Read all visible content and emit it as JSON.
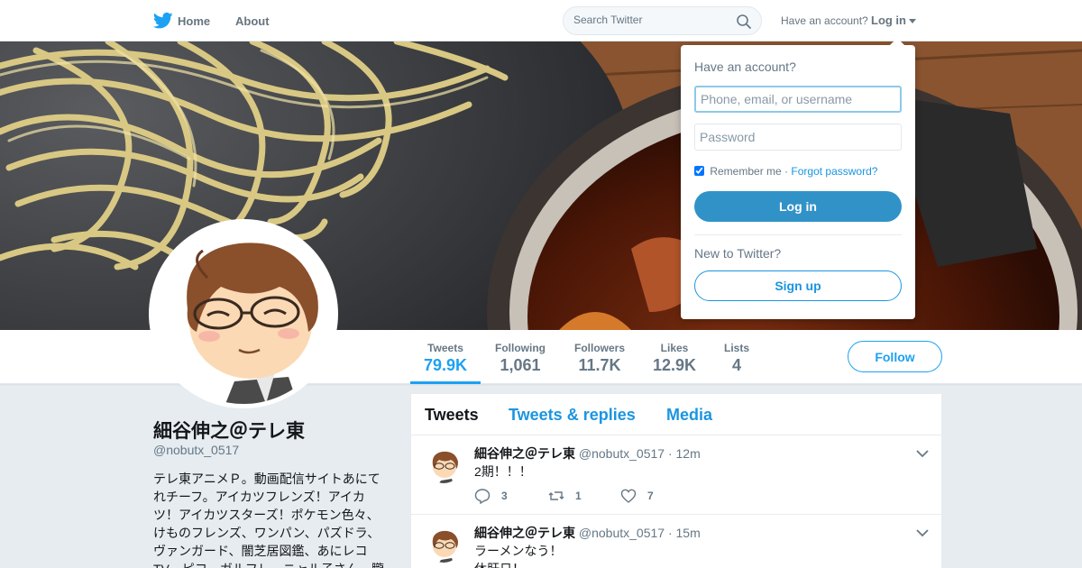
{
  "nav": {
    "home_label": "Home",
    "about_label": "About",
    "search_placeholder": "Search Twitter",
    "have_account_label": "Have an account?",
    "login_label": "Log in"
  },
  "profile": {
    "name": "細谷伸之＠テレ東",
    "handle": "@nobutx_0517",
    "bio": "テレ東アニメＰ。動画配信サイトあにてれチーフ。アイカツフレンズ！アイカツ！アイカツスターズ！ポケモン色々、けものフレンズ、ワンパン、パズドラ、ヴァンガード、闇芝居図鑑、あにレコTV、ピコ、ガルフレ、ニャル子さん、朧"
  },
  "stats": [
    {
      "label": "Tweets",
      "value": "79.9K"
    },
    {
      "label": "Following",
      "value": "1,061"
    },
    {
      "label": "Followers",
      "value": "11.7K"
    },
    {
      "label": "Likes",
      "value": "12.9K"
    },
    {
      "label": "Lists",
      "value": "4"
    }
  ],
  "follow_label": "Follow",
  "timeline": {
    "tabs": [
      "Tweets",
      "Tweets & replies",
      "Media"
    ],
    "tweets": [
      {
        "name": "細谷伸之＠テレ東",
        "handle": "@nobutx_0517",
        "time": "· 12m",
        "text": "2期！！！",
        "text2": "",
        "replies": "3",
        "retweets": "1",
        "likes": "7"
      },
      {
        "name": "細谷伸之＠テレ東",
        "handle": "@nobutx_0517",
        "time": "· 15m",
        "text": "ラーメンなう！",
        "text2": "休肝日！",
        "replies": "",
        "retweets": "",
        "likes": ""
      }
    ]
  },
  "login_dropdown": {
    "title": "Have an account?",
    "username_placeholder": "Phone, email, or username",
    "password_placeholder": "Password",
    "remember_label": "Remember me",
    "separator": "·",
    "forgot_label": "Forgot password?",
    "login_button": "Log in",
    "new_label": "New to Twitter?",
    "signup_button": "Sign up"
  },
  "colors": {
    "accent": "#1da1f2",
    "link": "#1b95e0",
    "login_button": "#3192c8",
    "muted": "#657786"
  }
}
